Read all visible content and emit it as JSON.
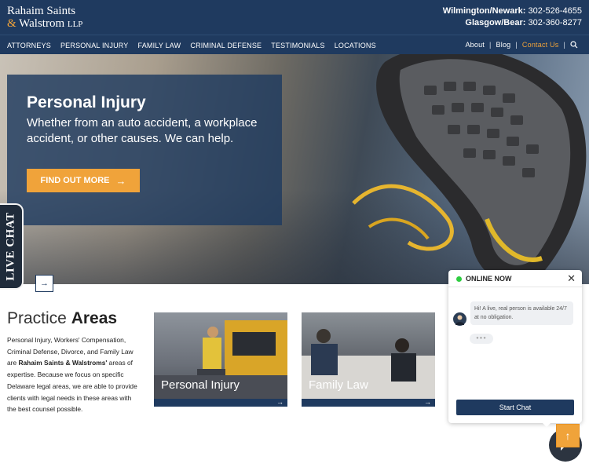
{
  "header": {
    "logo_line1": "Rahaim Saints",
    "logo_amp": "&",
    "logo_line2": "Walstrom",
    "logo_llp": "LLP",
    "phone1_label": "Wilmington/Newark:",
    "phone1_number": "302-526-4655",
    "phone2_label": "Glasgow/Bear:",
    "phone2_number": "302-360-8277"
  },
  "nav": {
    "items": [
      "ATTORNEYS",
      "PERSONAL INJURY",
      "FAMILY LAW",
      "CRIMINAL DEFENSE",
      "TESTIMONIALS",
      "LOCATIONS"
    ],
    "about": "About",
    "blog": "Blog",
    "contact": "Contact Us",
    "sep": "|",
    "icons": {
      "search": "search-icon"
    }
  },
  "hero": {
    "title": "Personal Injury",
    "text": "Whether from an auto accident, a workplace accident, or other causes. We can help.",
    "button": "FIND OUT MORE",
    "button_arrow": "→",
    "slider_next": "→"
  },
  "livechat_tab": "LIVE CHAT",
  "practice": {
    "title_light": "Practice",
    "title_bold": "Areas",
    "desc_start": "Personal Injury, Workers' Compensation, Criminal Defense, Divorce,  and Family Law  are ",
    "desc_bold": "Rahaim Saints & Walstroms'",
    "desc_end": " areas of expertise. Because we focus on specific Delaware legal areas, we are able to provide clients with legal needs in these areas with the best counsel possible.",
    "cards": [
      {
        "label": "Personal Injury",
        "arrow": "→"
      },
      {
        "label": "Family Law",
        "arrow": "→"
      }
    ]
  },
  "chat": {
    "status": "ONLINE NOW",
    "close": "✕",
    "message": "Hi! A live, real person is available 24/7 at no obligation.",
    "typing": "●●●",
    "start_button": "Start Chat",
    "scroll_top": "↑"
  },
  "colors": {
    "navy": "#1f3a5f",
    "accent_orange": "#f0a33a",
    "online_green": "#2ecc40"
  }
}
